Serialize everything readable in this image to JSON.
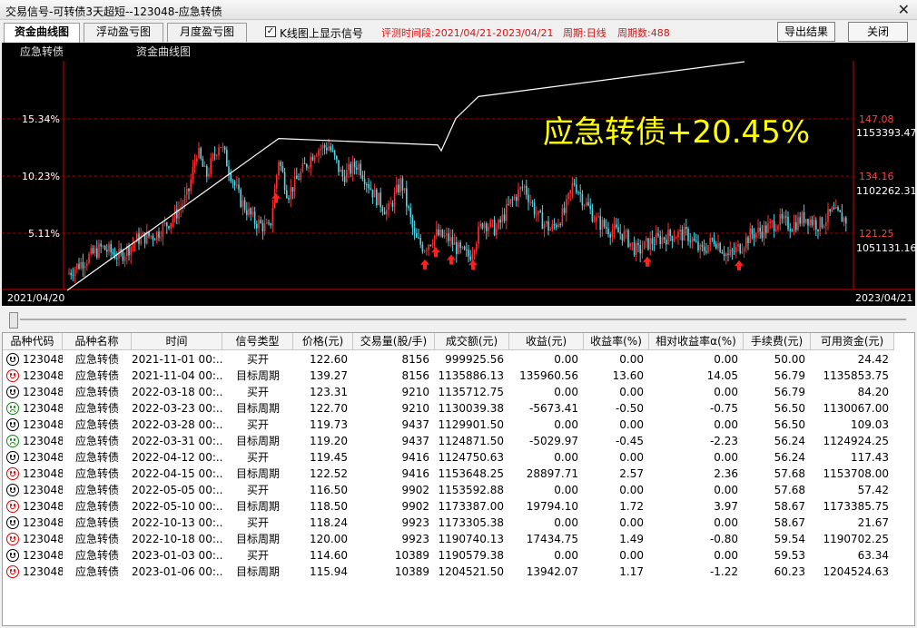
{
  "window": {
    "title": "交易信号-可转债3天超短--123048-应急转债",
    "close_glyph": "✕"
  },
  "tabs": [
    {
      "label": "资金曲线图",
      "active": true
    },
    {
      "label": "浮动盈亏图",
      "active": false
    },
    {
      "label": "月度盈亏图",
      "active": false
    }
  ],
  "options": {
    "show_signals_label": "K线图上显示信号",
    "show_signals_checked": true,
    "check_glyph": "✓"
  },
  "info": {
    "period_label": "评测时间段:2021/04/21-2023/04/21",
    "cycle_label": "周期:日线",
    "count_label": "周期数:488"
  },
  "buttons": {
    "export": "导出结果",
    "close": "关闭"
  },
  "chart": {
    "name_label": "应急转债",
    "curve_label": "资金曲线图",
    "headline": "应急转债+20.45%",
    "left_ticks": [
      "15.34%",
      "10.23%",
      "5.11%"
    ],
    "price_ticks": [
      "147.08",
      "134.16",
      "121.25"
    ],
    "equity_ticks": [
      "1153393.47",
      "1102262.31",
      "1051131.16"
    ],
    "start_date": "2021/04/20",
    "end_date": "2023/04/21",
    "colors": {
      "up": "#ff3030",
      "down": "#4ed8e8",
      "equity": "#ffffff",
      "grid": "#a00000",
      "headline": "#ffff00"
    }
  },
  "chart_data": {
    "type": "line",
    "title": "资金曲线图",
    "x_range": [
      "2021/04/20",
      "2023/04/21"
    ],
    "series": [
      {
        "name": "资金曲线图",
        "x": [
          "2021/04/20",
          "2021/11-01",
          "2022/03/18",
          "2022/03/31",
          "2022/04/15",
          "2022/05/10",
          "2022/10/18",
          "2023/01/06"
        ],
        "y": [
          1000000,
          1000000,
          1135853.75,
          1130067.0,
          1124924.25,
          1153708.0,
          1173385.75,
          1204524.63
        ]
      }
    ]
  },
  "table": {
    "columns": [
      "品种代码",
      "品种名称",
      "时间",
      "信号类型",
      "价格(元)",
      "交易量(股/手)",
      "成交额(元)",
      "收益(元)",
      "收益率(%)",
      "相对收益率α(%)",
      "手续费(元)",
      "可用资金(元)"
    ],
    "rows": [
      {
        "face": "happy",
        "code": "123048",
        "name": "应急转债",
        "time": "2021-11-01 00:...",
        "type": "买开",
        "price": "122.60",
        "vol": "8156",
        "amount": "999925.56",
        "profit": "0.00",
        "rate": "0.00",
        "alpha": "0.00",
        "fee": "50.00",
        "cash": "24.42"
      },
      {
        "face": "red",
        "code": "123048",
        "name": "应急转债",
        "time": "2021-11-04 00:...",
        "type": "目标周期",
        "price": "139.27",
        "vol": "8156",
        "amount": "1135886.13",
        "profit": "135960.56",
        "rate": "13.60",
        "alpha": "14.05",
        "fee": "56.79",
        "cash": "1135853.75"
      },
      {
        "face": "happy",
        "code": "123048",
        "name": "应急转债",
        "time": "2022-03-18 00:...",
        "type": "买开",
        "price": "123.31",
        "vol": "9210",
        "amount": "1135712.75",
        "profit": "0.00",
        "rate": "0.00",
        "alpha": "0.00",
        "fee": "56.79",
        "cash": "84.20"
      },
      {
        "face": "green",
        "code": "123048",
        "name": "应急转债",
        "time": "2022-03-23 00:...",
        "type": "目标周期",
        "price": "122.70",
        "vol": "9210",
        "amount": "1130039.38",
        "profit": "-5673.41",
        "rate": "-0.50",
        "alpha": "-0.75",
        "fee": "56.50",
        "cash": "1130067.00"
      },
      {
        "face": "happy",
        "code": "123048",
        "name": "应急转债",
        "time": "2022-03-28 00:...",
        "type": "买开",
        "price": "119.73",
        "vol": "9437",
        "amount": "1129901.50",
        "profit": "0.00",
        "rate": "0.00",
        "alpha": "0.00",
        "fee": "56.50",
        "cash": "109.03"
      },
      {
        "face": "green",
        "code": "123048",
        "name": "应急转债",
        "time": "2022-03-31 00:...",
        "type": "目标周期",
        "price": "119.20",
        "vol": "9437",
        "amount": "1124871.50",
        "profit": "-5029.97",
        "rate": "-0.45",
        "alpha": "-2.23",
        "fee": "56.24",
        "cash": "1124924.25"
      },
      {
        "face": "happy",
        "code": "123048",
        "name": "应急转债",
        "time": "2022-04-12 00:...",
        "type": "买开",
        "price": "119.45",
        "vol": "9416",
        "amount": "1124750.63",
        "profit": "0.00",
        "rate": "0.00",
        "alpha": "0.00",
        "fee": "56.24",
        "cash": "117.43"
      },
      {
        "face": "red",
        "code": "123048",
        "name": "应急转债",
        "time": "2022-04-15 00:...",
        "type": "目标周期",
        "price": "122.52",
        "vol": "9416",
        "amount": "1153648.25",
        "profit": "28897.71",
        "rate": "2.57",
        "alpha": "2.36",
        "fee": "57.68",
        "cash": "1153708.00"
      },
      {
        "face": "happy",
        "code": "123048",
        "name": "应急转债",
        "time": "2022-05-05 00:...",
        "type": "买开",
        "price": "116.50",
        "vol": "9902",
        "amount": "1153592.88",
        "profit": "0.00",
        "rate": "0.00",
        "alpha": "0.00",
        "fee": "57.68",
        "cash": "57.42"
      },
      {
        "face": "red",
        "code": "123048",
        "name": "应急转债",
        "time": "2022-05-10 00:...",
        "type": "目标周期",
        "price": "118.50",
        "vol": "9902",
        "amount": "1173387.00",
        "profit": "19794.10",
        "rate": "1.72",
        "alpha": "3.97",
        "fee": "58.67",
        "cash": "1173385.75"
      },
      {
        "face": "happy",
        "code": "123048",
        "name": "应急转债",
        "time": "2022-10-13 00:...",
        "type": "买开",
        "price": "118.24",
        "vol": "9923",
        "amount": "1173305.38",
        "profit": "0.00",
        "rate": "0.00",
        "alpha": "0.00",
        "fee": "58.67",
        "cash": "21.67"
      },
      {
        "face": "red",
        "code": "123048",
        "name": "应急转债",
        "time": "2022-10-18 00:...",
        "type": "目标周期",
        "price": "120.00",
        "vol": "9923",
        "amount": "1190740.13",
        "profit": "17434.75",
        "rate": "1.49",
        "alpha": "-0.80",
        "fee": "59.54",
        "cash": "1190702.25"
      },
      {
        "face": "happy",
        "code": "123048",
        "name": "应急转债",
        "time": "2023-01-03 00:...",
        "type": "买开",
        "price": "114.60",
        "vol": "10389",
        "amount": "1190579.38",
        "profit": "0.00",
        "rate": "0.00",
        "alpha": "0.00",
        "fee": "59.53",
        "cash": "63.34"
      },
      {
        "face": "red",
        "code": "123048",
        "name": "应急转债",
        "time": "2023-01-06 00:...",
        "type": "目标周期",
        "price": "115.94",
        "vol": "10389",
        "amount": "1204521.50",
        "profit": "13942.07",
        "rate": "1.17",
        "alpha": "-1.22",
        "fee": "60.23",
        "cash": "1204524.63"
      }
    ]
  }
}
